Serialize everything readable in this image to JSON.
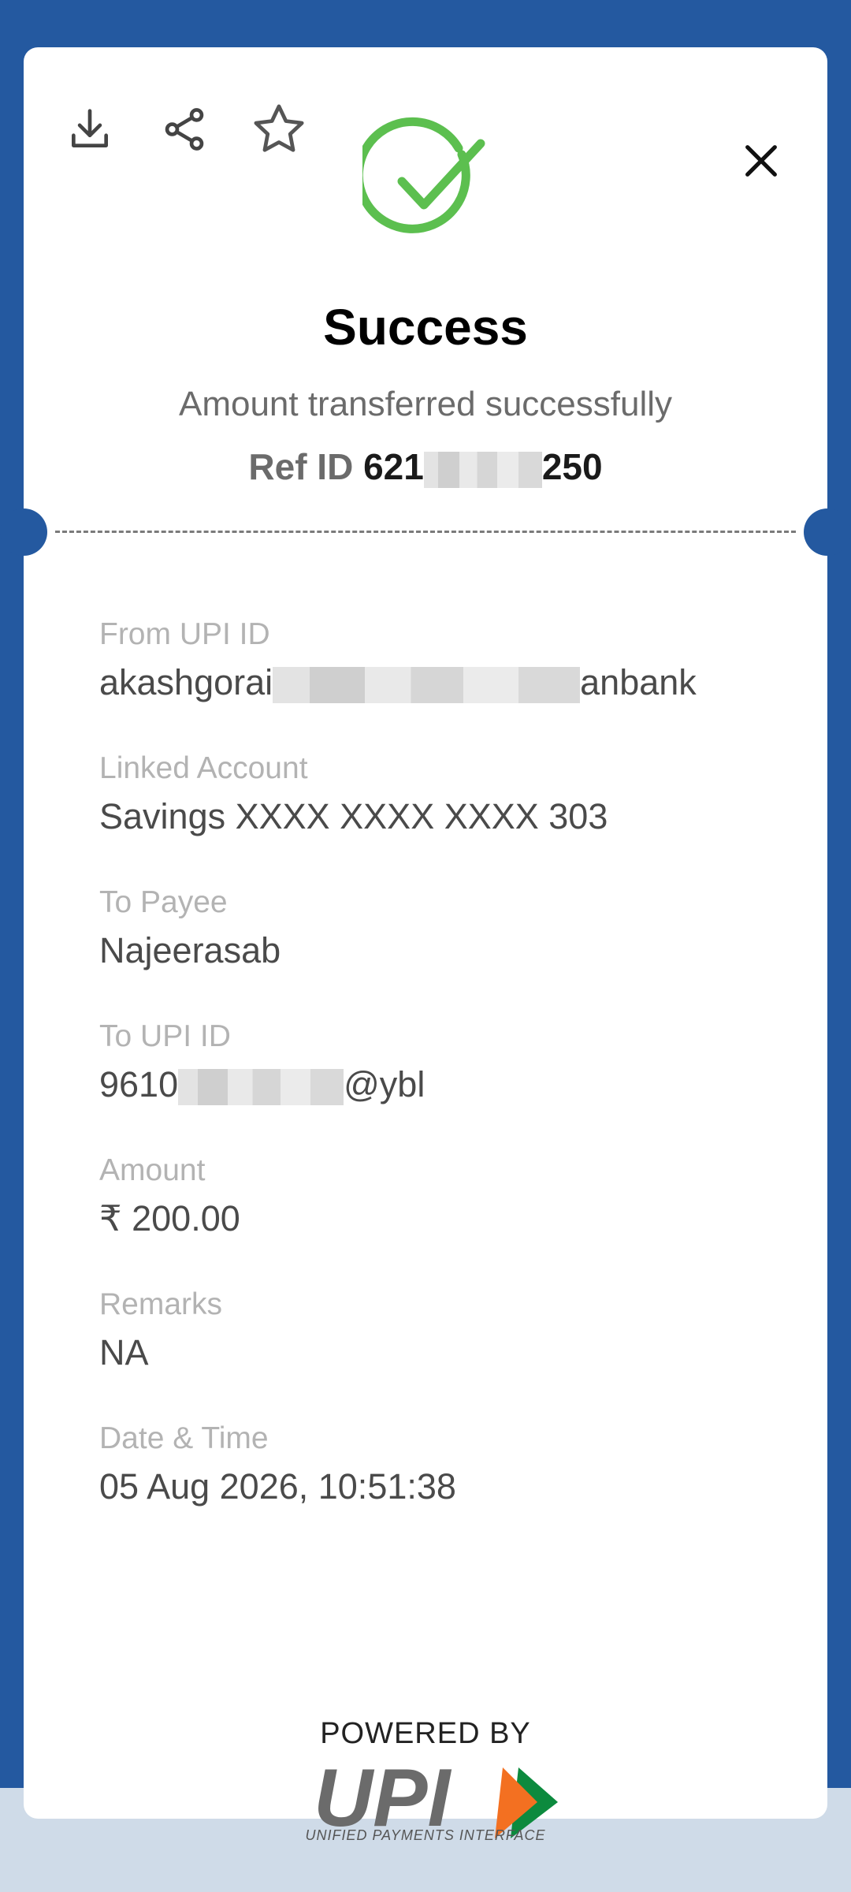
{
  "status": {
    "title": "Success",
    "subtitle": "Amount transferred successfully",
    "ref_label": "Ref ID",
    "ref_prefix": "621",
    "ref_suffix": "250"
  },
  "details": {
    "from_upi": {
      "label": "From UPI ID",
      "value_prefix": "akashgorai",
      "value_suffix": "anbank"
    },
    "linked_account": {
      "label": "Linked Account",
      "value": "Savings XXXX XXXX XXXX 303"
    },
    "to_payee": {
      "label": "To Payee",
      "value": "Najeerasab"
    },
    "to_upi": {
      "label": "To UPI ID",
      "value_prefix": "9610",
      "value_suffix": "@ybl"
    },
    "amount": {
      "label": "Amount",
      "value": "₹ 200.00"
    },
    "remarks": {
      "label": "Remarks",
      "value": "NA"
    },
    "datetime": {
      "label": "Date & Time",
      "value": "05 Aug 2026, 10:51:38"
    }
  },
  "footer": {
    "powered_by": "POWERED BY",
    "logo_text": "UPI",
    "tagline": "UNIFIED PAYMENTS INTERFACE"
  },
  "icons": {
    "download": "download-icon",
    "share": "share-icon",
    "favorite": "star-icon",
    "close": "close-icon",
    "success": "check-circle-icon"
  },
  "colors": {
    "background": "#2459a0",
    "success_green": "#5cbf4f",
    "card": "#ffffff",
    "upi_orange": "#f37021",
    "upi_green": "#0c8a3e"
  }
}
